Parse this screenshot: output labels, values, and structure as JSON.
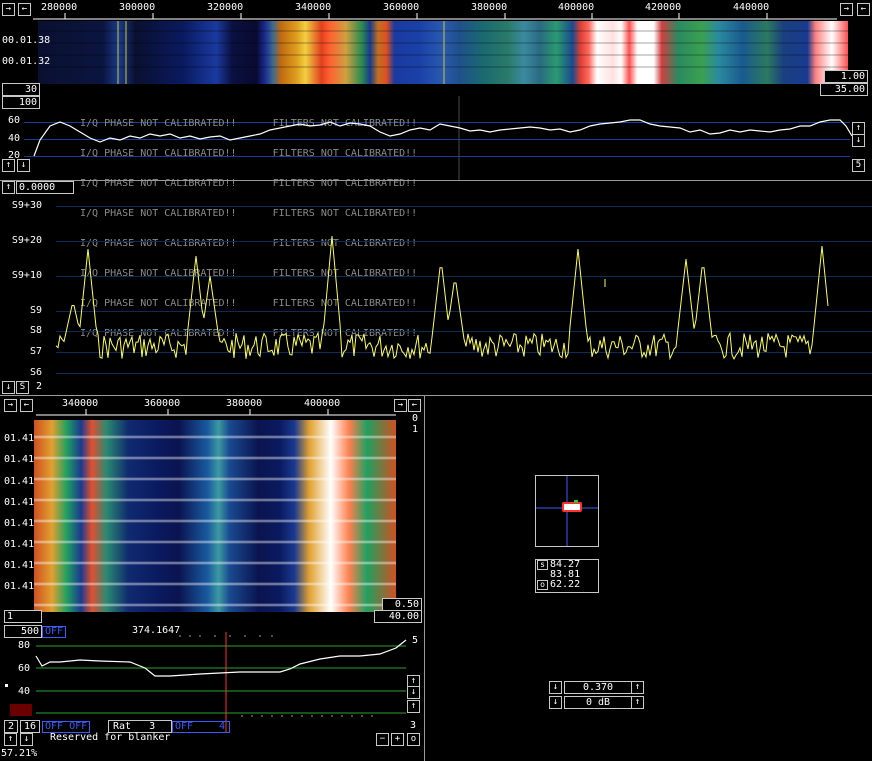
{
  "main_wf": {
    "freq_ticks": [
      "280000",
      "300000",
      "320000",
      "340000",
      "360000",
      "380000",
      "400000",
      "420000",
      "440000"
    ],
    "time_labels": [
      "00.01.38",
      "00.01.32"
    ],
    "left_value": "30",
    "right_values": [
      "1.00",
      "35.00"
    ]
  },
  "avg_spectrum": {
    "top_value": "100",
    "y_labels": [
      "60",
      "40",
      "20"
    ],
    "warnings": [
      "I/Q PHASE NOT CALIBRATED!!      FILTERS NOT CALIBRATED!!",
      "I/Q PHASE NOT CALIBRATED!!      FILTERS NOT CALIBRATED!!",
      "I/Q PHASE NOT CALIBRATED!!      FILTERS NOT CALIBRATED!!",
      "I/Q PHASE NOT CALIBRATED!!      FILTERS NOT CALIBRATED!!",
      "I/Q PHASE NOT CALIBRATED!!      FILTERS NOT CALIBRATED!!",
      "I/Q PHASE NOT CALIBRATED!!      FILTERS NOT CALIBRATED!!",
      "I/Q PHASE NOT CALIBRATED!!      FILTERS NOT CALIBRATED!!",
      "I/Q PHASE NOT CALIBRATED!!      FILTERS NOT CALIBRATED!!"
    ],
    "right_value": "5"
  },
  "hires": {
    "offset_value": "0.0000",
    "s_labels": [
      "S9+30",
      "S9+20",
      "S9+10",
      "S9",
      "S8",
      "S7",
      "S6"
    ],
    "bottom_s_btn": "S",
    "bottom_value": "2"
  },
  "baseband_wf": {
    "freq_ticks": [
      "340000",
      "360000",
      "380000",
      "400000"
    ],
    "time_labels": [
      "01.41",
      "01.41",
      "01.41",
      "01.41",
      "01.41",
      "01.41",
      "01.41",
      "01.41"
    ],
    "right_top": [
      "0",
      "1"
    ],
    "bottom_left": "1",
    "right_values": [
      "0.50",
      "40.00"
    ]
  },
  "baseband": {
    "bw_value": "500",
    "bw_mode": "OFF",
    "center_freq": "374.1647",
    "y_labels": [
      "80",
      "60",
      "40"
    ],
    "right_top": "5",
    "right_bottom": "3",
    "bottom_row": {
      "b2": "2",
      "b16": "16",
      "off_off": "OFF OFF",
      "rat_label": "Rat",
      "rat_value": "3",
      "off_a": "OFF",
      "off_b": "4"
    },
    "status": "Reserved for blanker",
    "minus": "−",
    "plus": "+",
    "o": "o"
  },
  "meter": {
    "values": [
      "84.27",
      "83.81",
      "62.22"
    ],
    "prefixes": [
      "s",
      "",
      "o"
    ]
  },
  "gain": {
    "values": [
      "0.370",
      "0 dB"
    ]
  },
  "cpu_load": "57.21%",
  "colors": {
    "trace_yellow": "#ffff55",
    "grid_blue": "#0d2a5a",
    "cursor_red": "#ff3030",
    "green_grid": "#2aa52a"
  }
}
